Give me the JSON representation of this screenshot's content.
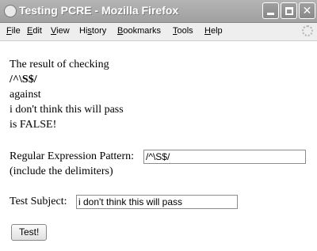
{
  "window": {
    "title": "Testing PCRE - Mozilla Firefox",
    "buttons": {
      "minimize": "minimize",
      "maximize": "maximize",
      "close": "✕"
    }
  },
  "menu": [
    {
      "first": "F",
      "rest": "ile"
    },
    {
      "first": "E",
      "rest": "dit"
    },
    {
      "first": "V",
      "rest": "iew"
    },
    {
      "first": "",
      "rest": "Hi",
      "u": "s",
      "after": "tory"
    },
    {
      "first": "B",
      "rest": "ookmarks"
    },
    {
      "first": "T",
      "rest": "ools"
    },
    {
      "first": "H",
      "rest": "elp"
    }
  ],
  "result": {
    "intro": "The result of checking",
    "pattern": "/^\\S$/",
    "against_label": "against",
    "subject": "i don't think this will pass",
    "outcome": "is FALSE!"
  },
  "form": {
    "pattern_label": "Regular Expression Pattern:",
    "pattern_value": "/^\\S$/",
    "pattern_hint": "(include the delimiters)",
    "subject_label": "Test Subject:",
    "subject_value": "i don't think this will pass",
    "submit_label": "Test!"
  }
}
